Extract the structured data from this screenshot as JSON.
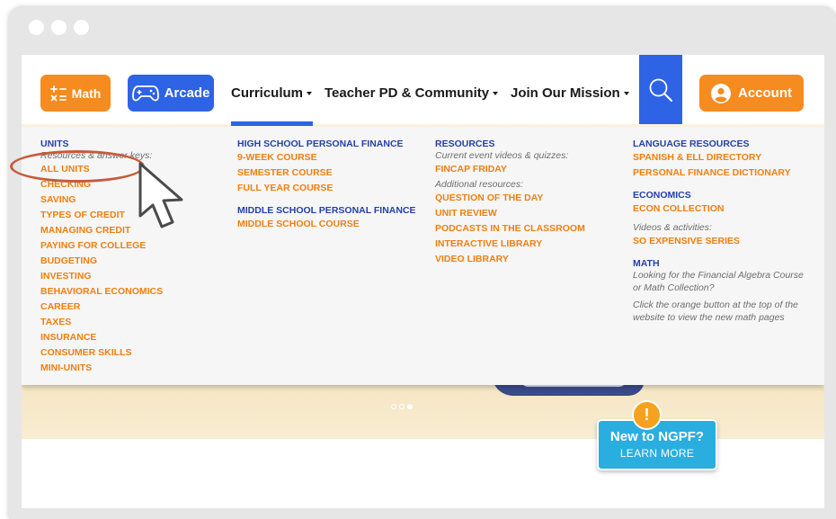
{
  "nav": {
    "math_label": "Math",
    "arcade_label": "Arcade",
    "curriculum_label": "Curriculum",
    "teacher_label": "Teacher PD & Community",
    "mission_label": "Join Our Mission",
    "account_label": "Account"
  },
  "columns": {
    "units": {
      "heading": "UNITS",
      "subtitle": "Resources & answer keys:",
      "items": [
        "ALL UNITS",
        "CHECKING",
        "SAVING",
        "TYPES OF CREDIT",
        "MANAGING CREDIT",
        "PAYING FOR COLLEGE",
        "BUDGETING",
        "INVESTING",
        "BEHAVIORAL ECONOMICS",
        "CAREER",
        "TAXES",
        "INSURANCE",
        "CONSUMER SKILLS",
        "MINI-UNITS"
      ]
    },
    "courses": {
      "hs_heading": "HIGH SCHOOL PERSONAL FINANCE",
      "hs_items": [
        "9-WEEK COURSE",
        "SEMESTER COURSE",
        "FULL YEAR COURSE"
      ],
      "ms_heading": "MIDDLE SCHOOL PERSONAL FINANCE",
      "ms_items": [
        "MIDDLE SCHOOL COURSE"
      ]
    },
    "resources": {
      "heading": "RESOURCES",
      "sub1": "Current event videos & quizzes:",
      "link1": "FINCAP FRIDAY",
      "sub2": "Additional resources:",
      "items": [
        "QUESTION OF THE DAY",
        "UNIT REVIEW",
        "PODCASTS IN THE CLASSROOM",
        "INTERACTIVE LIBRARY",
        "VIDEO LIBRARY"
      ]
    },
    "language": {
      "heading": "LANGUAGE RESOURCES",
      "items": [
        "SPANISH & ELL DIRECTORY",
        "PERSONAL FINANCE DICTIONARY"
      ],
      "econ_heading": "ECONOMICS",
      "econ_link": "ECON COLLECTION",
      "econ_sub": "Videos & activities:",
      "econ_link2": "SO EXPENSIVE SERIES",
      "math_heading": "MATH",
      "math_note1": "Looking for the Financial Algebra Course or Math Collection?",
      "math_note2": "Click the orange button at the top of the website to view the new math pages"
    }
  },
  "badge": {
    "alert": "!",
    "title": "New to NGPF?",
    "subtitle": "LEARN MORE"
  },
  "colors": {
    "orange": "#f68b1f",
    "blue": "#2e63e6",
    "heading_blue": "#2540a8",
    "link_orange": "#f07e10",
    "badge_blue": "#2aaee0"
  },
  "icons": [
    "math-operations-icon",
    "gamepad-icon",
    "search-icon",
    "user-circle-icon",
    "mouse-cursor-icon"
  ]
}
